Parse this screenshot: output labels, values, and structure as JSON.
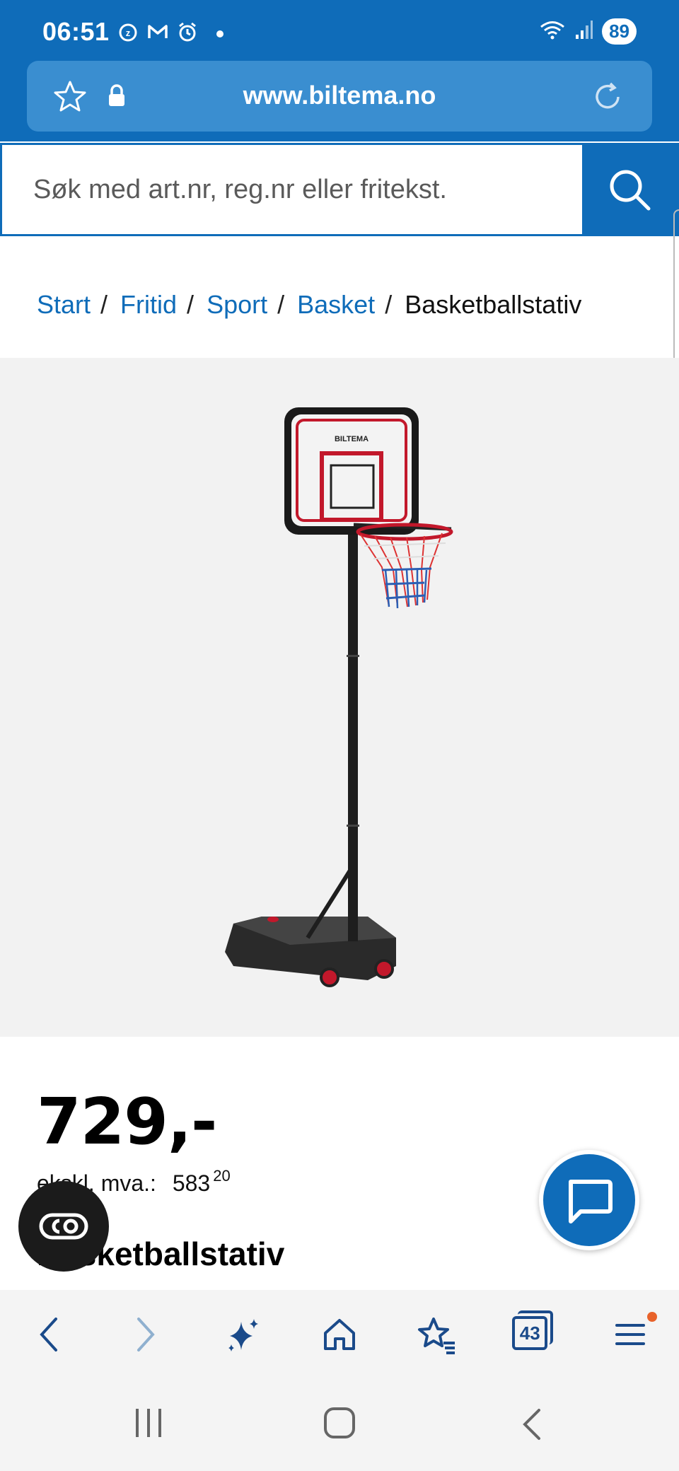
{
  "status_bar": {
    "time": "06:51",
    "battery": "89",
    "icons": [
      "z-alarm-icon",
      "gmail-icon",
      "alarm-clock-icon",
      "notification-dot",
      "wifi-icon",
      "signal-icon"
    ]
  },
  "browser": {
    "url": "www.biltema.no"
  },
  "search": {
    "placeholder": "Søk med art.nr, reg.nr eller fritekst."
  },
  "breadcrumb": {
    "items": [
      "Start",
      "Fritid",
      "Sport",
      "Basket"
    ],
    "separator": "/",
    "current": "Basketballstativ"
  },
  "product": {
    "image_brand": "BILTEMA",
    "price": "729,-",
    "ex_vat_label": "ekskl. mva.:",
    "ex_vat_value": "583",
    "ex_vat_decimals": "20",
    "title": "Basketballstativ"
  },
  "bottom_nav": {
    "tabs_count": "43",
    "items": [
      "back-icon",
      "forward-icon",
      "sparkle-icon",
      "home-icon",
      "bookmarks-icon",
      "tabs-icon",
      "menu-icon"
    ]
  },
  "colors": {
    "brand_blue": "#0f6cb9",
    "url_bar": "#3a8ed0",
    "image_bg": "#f2f2f2",
    "nav_icon": "#1a4a8a",
    "notification": "#e8622a"
  }
}
